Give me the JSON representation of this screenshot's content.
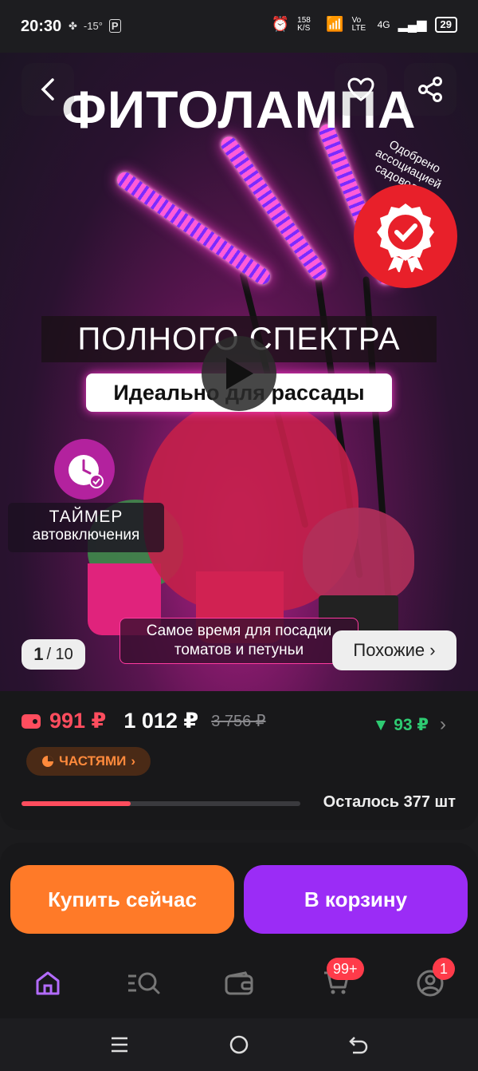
{
  "status": {
    "time": "20:30",
    "temp": "-15°",
    "net_speed": "158 K/S",
    "lte": "Vo LTE",
    "signal": "4G",
    "battery": "29"
  },
  "hero": {
    "headline": "ФИТОЛАМПА",
    "approved_text": "Одобрено ассоциацией садоводов",
    "banner_main": "ПОЛНОГО СПЕКТРА",
    "banner_sub": "Идеально для рассады",
    "timer_line1": "ТАЙМЕР",
    "timer_line2": "автовключения",
    "tomatoes_line1": "Самое время для посадки",
    "tomatoes_line2": "томатов и петуньи",
    "page_current": "1",
    "page_total": "/ 10",
    "similar_label": "Похожие ›"
  },
  "price": {
    "main": "991 ₽",
    "second": "1 012 ₽",
    "old": "3 756 ₽",
    "cashback": "93 ₽",
    "parts_label": "ЧАСТЯМИ",
    "remaining": "Осталось 377 шт",
    "stock_fraction": 0.39
  },
  "actions": {
    "buy_now": "Купить сейчас",
    "add_to_cart": "В корзину"
  },
  "tabbar": {
    "cart_badge": "99+",
    "profile_badge": "1"
  },
  "colors": {
    "accent_red": "#ff4d5e",
    "accent_orange": "#ff7a28",
    "accent_purple": "#9b2cf6",
    "cashback_green": "#2ecb72"
  }
}
